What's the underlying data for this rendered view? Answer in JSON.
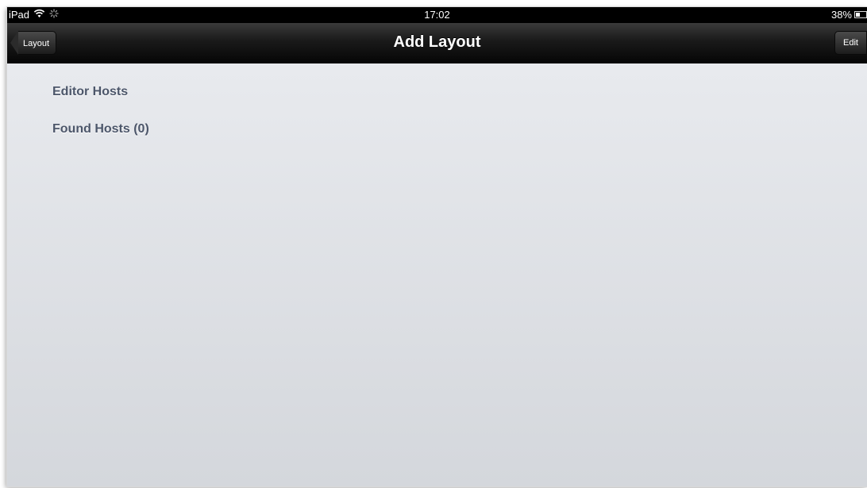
{
  "status_bar": {
    "device": "iPad",
    "time": "17:02",
    "battery_percent": "38%",
    "battery_level": 0.38,
    "icons": [
      "wifi-icon",
      "activity-spinner-icon",
      "battery-icon"
    ]
  },
  "nav_bar": {
    "title": "Add Layout",
    "back_label": "Layout",
    "edit_label": "Edit"
  },
  "sections": [
    {
      "title": "Editor Hosts"
    },
    {
      "title": "Found Hosts (0)"
    }
  ],
  "colors": {
    "nav_background": "#0c0c0c",
    "content_background": "#e3e5e9",
    "section_text": "#4c566a"
  }
}
